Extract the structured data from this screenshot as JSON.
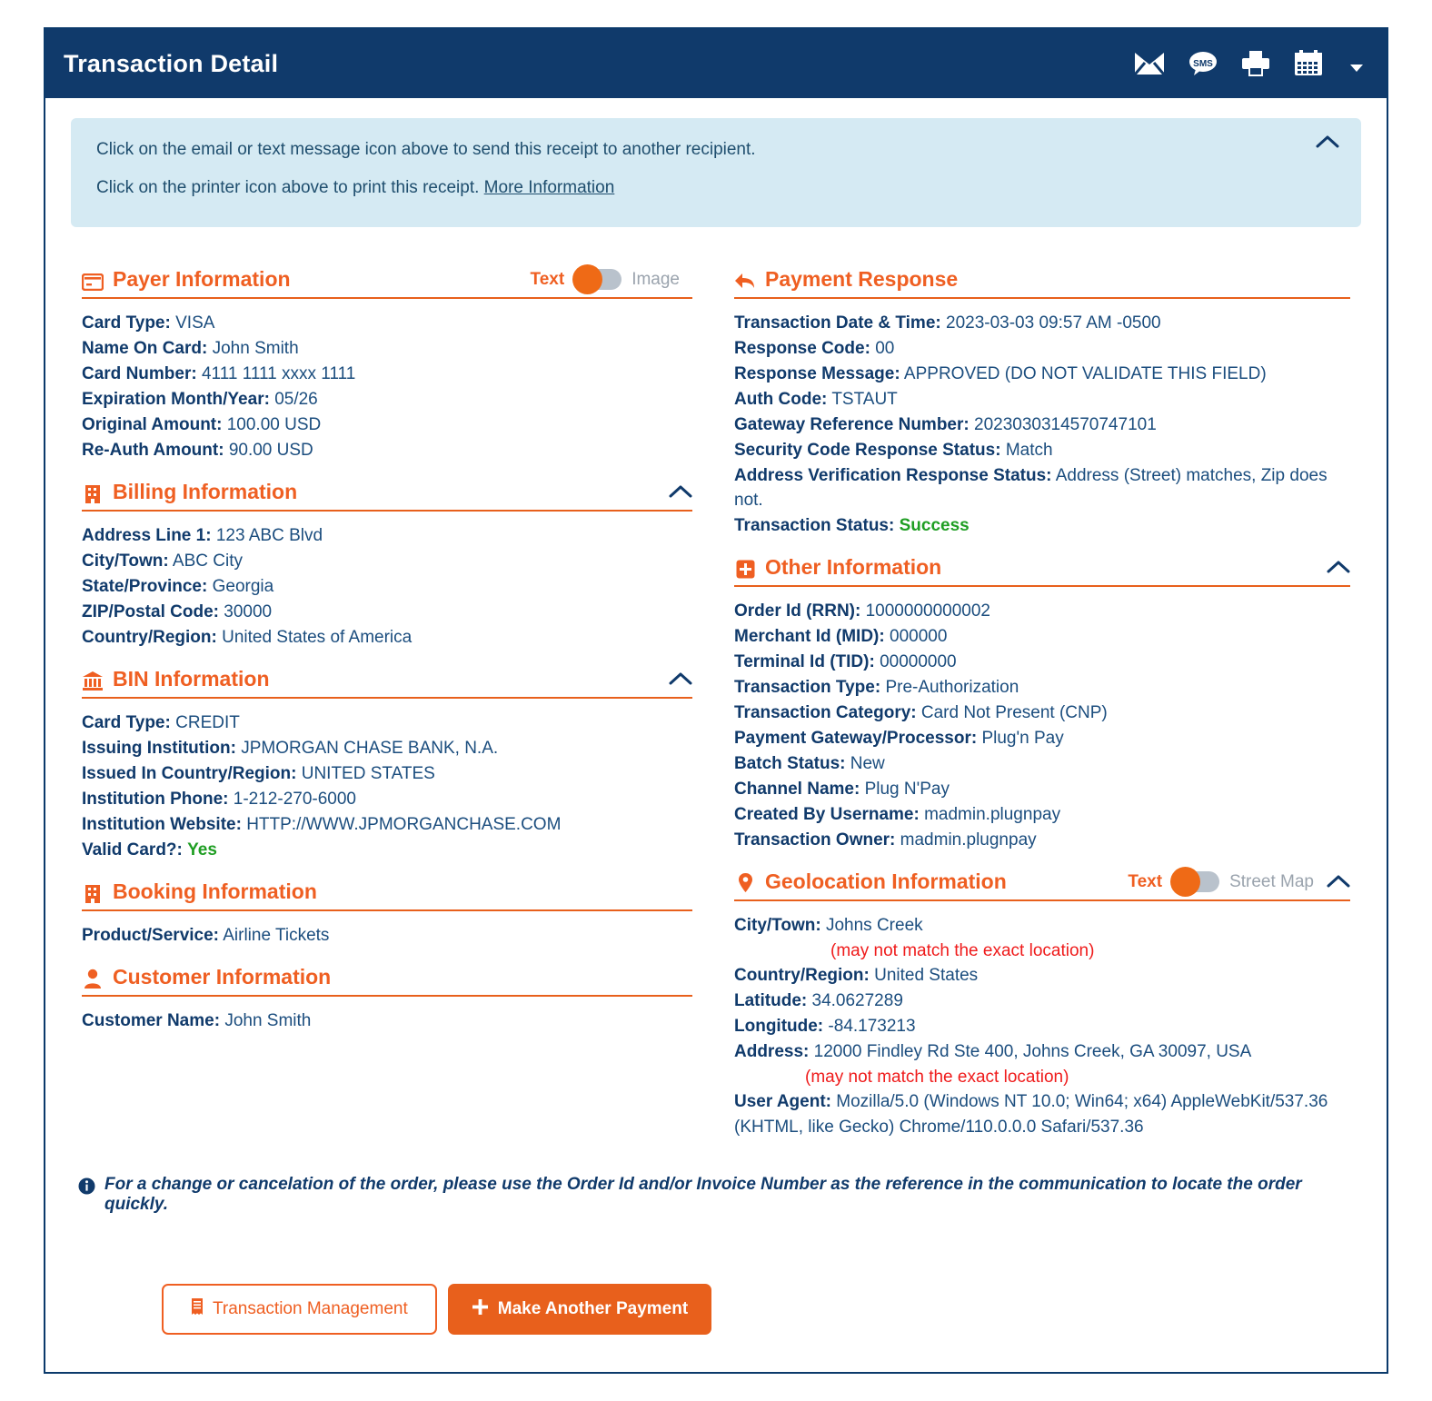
{
  "header": {
    "title": "Transaction Detail",
    "icons": [
      {
        "name": "email-icon",
        "label": "Email"
      },
      {
        "name": "sms-icon",
        "label": "SMS"
      },
      {
        "name": "print-icon",
        "label": "Print"
      },
      {
        "name": "calendar-icon",
        "label": "Calendar"
      }
    ]
  },
  "banner": {
    "line1": "Click on the email or text message icon above to send this receipt to another recipient.",
    "line2": "Click on the printer icon above to print this receipt.",
    "link": "More Information"
  },
  "payer": {
    "title": "Payer Information",
    "toggle": {
      "left": "Text",
      "right": "Image",
      "active": "left"
    },
    "rows": [
      {
        "k": "Card Type:",
        "v": "VISA"
      },
      {
        "k": "Name On Card:",
        "v": "John Smith"
      },
      {
        "k": "Card Number:",
        "v": "4111 1111 xxxx 1111"
      },
      {
        "k": "Expiration Month/Year:",
        "v": "05/26"
      },
      {
        "k": "Original Amount:",
        "v": "100.00 USD"
      },
      {
        "k": "Re-Auth Amount:",
        "v": "90.00 USD"
      }
    ]
  },
  "billing": {
    "title": "Billing Information",
    "rows": [
      {
        "k": "Address Line 1:",
        "v": "123 ABC Blvd"
      },
      {
        "k": "City/Town:",
        "v": "ABC City"
      },
      {
        "k": "State/Province:",
        "v": "Georgia"
      },
      {
        "k": "ZIP/Postal Code:",
        "v": "30000"
      },
      {
        "k": "Country/Region:",
        "v": "United States of America"
      }
    ]
  },
  "bin": {
    "title": "BIN Information",
    "rows": [
      {
        "k": "Card Type:",
        "v": "CREDIT"
      },
      {
        "k": "Issuing Institution:",
        "v": "JPMORGAN CHASE BANK, N.A."
      },
      {
        "k": "Issued In Country/Region:",
        "v": "UNITED STATES"
      },
      {
        "k": "Institution Phone:",
        "v": "1-212-270-6000"
      },
      {
        "k": "Institution Website:",
        "v": "HTTP://WWW.JPMORGANCHASE.COM"
      },
      {
        "k": "Valid Card?:",
        "v": "Yes",
        "green": true
      }
    ]
  },
  "booking": {
    "title": "Booking Information",
    "rows": [
      {
        "k": "Product/Service:",
        "v": "Airline Tickets"
      }
    ]
  },
  "customer": {
    "title": "Customer Information",
    "rows": [
      {
        "k": "Customer Name:",
        "v": "John Smith"
      }
    ]
  },
  "response": {
    "title": "Payment Response",
    "rows": [
      {
        "k": "Transaction Date & Time:",
        "v": "2023-03-03 09:57 AM -0500"
      },
      {
        "k": "Response Code:",
        "v": "00"
      },
      {
        "k": "Response Message:",
        "v": "APPROVED (DO NOT VALIDATE THIS FIELD)"
      },
      {
        "k": "Auth Code:",
        "v": "TSTAUT"
      },
      {
        "k": "Gateway Reference Number:",
        "v": "2023030314570747101"
      },
      {
        "k": "Security Code Response Status:",
        "v": "Match"
      },
      {
        "k": "Address Verification Response Status:",
        "v": "Address (Street) matches, Zip does not."
      },
      {
        "k": "Transaction Status:",
        "v": "Success",
        "green": true
      }
    ]
  },
  "other": {
    "title": "Other Information",
    "rows": [
      {
        "k": "Order Id (RRN):",
        "v": "1000000000002"
      },
      {
        "k": "Merchant Id (MID):",
        "v": "000000"
      },
      {
        "k": "Terminal Id (TID):",
        "v": "00000000"
      },
      {
        "k": "Transaction Type:",
        "v": "Pre-Authorization"
      },
      {
        "k": "Transaction Category:",
        "v": "Card Not Present (CNP)"
      },
      {
        "k": "Payment Gateway/Processor:",
        "v": "Plug'n Pay"
      },
      {
        "k": "Batch Status:",
        "v": "New"
      },
      {
        "k": "Channel Name:",
        "v": "Plug N'Pay"
      },
      {
        "k": "Created By Username:",
        "v": "madmin.plugnpay"
      },
      {
        "k": "Transaction Owner:",
        "v": "madmin.plugnpay"
      }
    ]
  },
  "geo": {
    "title": "Geolocation Information",
    "toggle": {
      "left": "Text",
      "right": "Street Map",
      "active": "left"
    },
    "city_k": "City/Town:",
    "city_v": "Johns Creek",
    "city_note": "(may not match the exact location)",
    "rows": [
      {
        "k": "Country/Region:",
        "v": "United States"
      },
      {
        "k": "Latitude:",
        "v": "34.0627289"
      },
      {
        "k": "Longitude:",
        "v": "-84.173213"
      }
    ],
    "address_k": "Address:",
    "address_v": "12000 Findley Rd Ste 400, Johns Creek, GA 30097, USA",
    "address_note": "(may not match the exact location)",
    "ua_k": "User Agent:",
    "ua_v": "Mozilla/5.0 (Windows NT 10.0; Win64; x64) AppleWebKit/537.36",
    "ua_v2": "(KHTML, like Gecko) Chrome/110.0.0.0 Safari/537.36"
  },
  "footer": {
    "note": "For a change or cancelation of the order, please use the Order Id and/or Invoice Number as the reference in the communication to locate the order quickly.",
    "btn_manage": "Transaction Management",
    "btn_pay": "Make Another Payment"
  },
  "colors": {
    "header_navy": "#103a6b",
    "accent_orange": "#ef5f22",
    "banner_blue": "#d5eaf3",
    "success_green": "#1f9e23",
    "warn_red": "#ef1b1b"
  }
}
